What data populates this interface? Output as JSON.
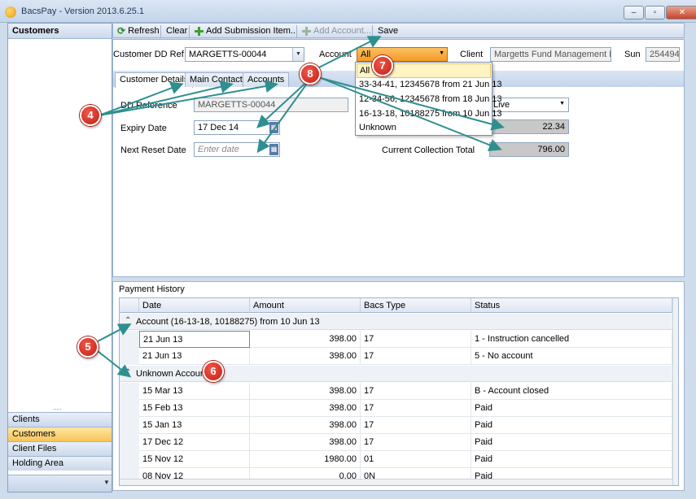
{
  "window": {
    "title": "BacsPay - Version 2013.6.25.1",
    "controls": {
      "minimize": "–",
      "maximize": "▫",
      "close": "✕"
    }
  },
  "sidebar": {
    "header": "Customers",
    "items": [
      {
        "label": "Clients",
        "active": false
      },
      {
        "label": "Customers",
        "active": true
      },
      {
        "label": "Client Files",
        "active": false
      },
      {
        "label": "Holding Area",
        "active": false
      }
    ]
  },
  "toolbar": {
    "refresh": "Refresh",
    "clear": "Clear",
    "add_submission": "Add Submission Item...",
    "add_account": "Add Account...",
    "save": "Save"
  },
  "form": {
    "customer_ref_label": "Customer DD Ref",
    "customer_ref_value": "MARGETTS-00044",
    "account_label": "Account",
    "account_value": "All",
    "client_label": "Client",
    "client_value": "Margetts Fund Management Ltd",
    "sun_label": "Sun",
    "sun_value": "254494",
    "tabs": [
      "Customer Details",
      "Main Contact",
      "Accounts"
    ],
    "dd_reference_label": "DD Reference",
    "dd_reference_value": "MARGETTS-00044",
    "expiry_label": "Expiry Date",
    "expiry_value": "17 Dec 14",
    "next_reset_label": "Next Reset Date",
    "next_reset_placeholder": "Enter date",
    "status_value": "Live",
    "amount_value": "22.34",
    "collection_total_label": "Current Collection Total",
    "collection_total_value": "796.00"
  },
  "account_dropdown": {
    "options": [
      "All",
      "33-34-41, 12345678 from 21 Jun 13",
      "12-34-56, 12345678 from 18 Jun 13",
      "16-13-18, 10188275 from 10 Jun 13",
      "Unknown"
    ],
    "selected": "All"
  },
  "history": {
    "title": "Payment History",
    "columns": [
      "Date",
      "Amount",
      "Bacs Type",
      "Status"
    ],
    "groups": [
      {
        "label": "Account (16-13-18, 10188275) from 10 Jun 13",
        "rows": [
          {
            "date": "21 Jun 13",
            "amount": "398.00",
            "type": "17",
            "status": "1 - Instruction cancelled"
          },
          {
            "date": "21 Jun 13",
            "amount": "398.00",
            "type": "17",
            "status": "5 - No account"
          }
        ]
      },
      {
        "label": "Unknown Account",
        "rows": [
          {
            "date": "15 Mar 13",
            "amount": "398.00",
            "type": "17",
            "status": "B - Account closed"
          },
          {
            "date": "15 Feb 13",
            "amount": "398.00",
            "type": "17",
            "status": "Paid"
          },
          {
            "date": "15 Jan 13",
            "amount": "398.00",
            "type": "17",
            "status": "Paid"
          },
          {
            "date": "17 Dec 12",
            "amount": "398.00",
            "type": "17",
            "status": "Paid"
          },
          {
            "date": "15 Nov 12",
            "amount": "1980.00",
            "type": "01",
            "status": "Paid"
          },
          {
            "date": "08 Nov 12",
            "amount": "0.00",
            "type": "0N",
            "status": "Paid"
          }
        ]
      }
    ]
  },
  "callouts": [
    "4",
    "5",
    "6",
    "7",
    "8"
  ],
  "colors": {
    "callout": "#d9281c",
    "arrow": "#2f8f8f",
    "accent": "#f49a25"
  }
}
